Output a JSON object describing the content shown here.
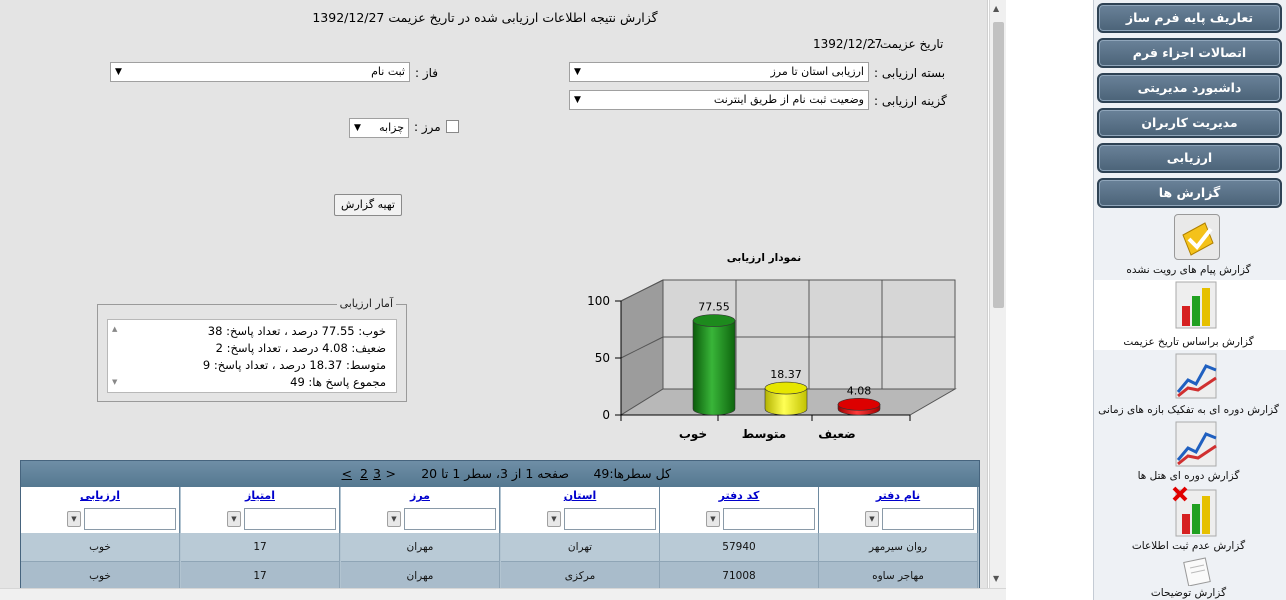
{
  "header": {
    "title": "گزارش نتیجه اطلاعات ارزیابی شده در تاریخ عزیمت 1392/12/27"
  },
  "form": {
    "travel_date_label": "تاریخ عزیمت :",
    "travel_date_value": "1392/12/27",
    "package_label": "بسته ارزیابی :",
    "package_value": "ارزیابی استان تا مرز",
    "phase_label": "فاز :",
    "phase_value": "ثبت نام",
    "option_label": "گزینه ارزیابی :",
    "option_value": "وضعیت ثبت نام از طریق اینترنت",
    "border_label": "مرز :",
    "border_value": "چزابه",
    "generate_button": "تهیه گزارش"
  },
  "stats": {
    "legend": "آمار ارزیابی",
    "lines": [
      "خوب: 77.55 درصد ، تعداد پاسخ: 38",
      "ضعیف: 4.08 درصد ، تعداد پاسخ: 2",
      "متوسط: 18.37 درصد ، تعداد پاسخ: 9",
      "مجموع پاسخ ها: 49"
    ]
  },
  "chart_data": {
    "type": "bar",
    "title": "نمودار ارزیابی",
    "categories": [
      "خوب",
      "متوسط",
      "ضعیف"
    ],
    "values": [
      77.55,
      18.37,
      4.08
    ],
    "colors": [
      "#1d8a1d",
      "#e6e600",
      "#dd0000"
    ],
    "ylim": [
      0,
      100
    ],
    "yticks": [
      0,
      50,
      100
    ],
    "grid": true
  },
  "grid": {
    "pager": {
      "total": "کل سطرها:49",
      "page_info": "صفحه 1 از 3، سطر 1 تا 20",
      "prev": "<",
      "page2": "2",
      "page3": "3",
      "next": ">"
    },
    "columns": [
      "نام دفتر",
      "کد دفتر",
      "استان",
      "مرز",
      "امتیاز",
      "ارزیابی"
    ],
    "rows": [
      [
        "روان سیرمهر",
        "57940",
        "تهران",
        "مهران",
        "17",
        "خوب"
      ],
      [
        "مهاجر ساوه",
        "71008",
        "مرکزی",
        "مهران",
        "17",
        "خوب"
      ]
    ]
  },
  "menu": {
    "buttons": [
      "تعاریف پایه فرم ساز",
      "اتصالات اجزاء فرم",
      "داشبورد مدیریتی",
      "مدیریت کاربران",
      "ارزیابی",
      "گزارش ها"
    ],
    "reports": [
      {
        "label": "گزارش پیام های رویت نشده",
        "icon": "envelope-check-icon"
      },
      {
        "label": "گزارش براساس تاریخ عزیمت",
        "icon": "bar-chart-icon"
      },
      {
        "label": "گزارش دوره ای به تفکیک بازه های زمانی",
        "icon": "line-chart-icon"
      },
      {
        "label": "گزارش دوره ای هتل ها",
        "icon": "line-chart-icon"
      },
      {
        "label": "گزارش عدم ثبت اطلاعات",
        "icon": "bar-chart-error-icon"
      },
      {
        "label": "گزارش توضیحات",
        "icon": "notepad-icon"
      }
    ]
  }
}
